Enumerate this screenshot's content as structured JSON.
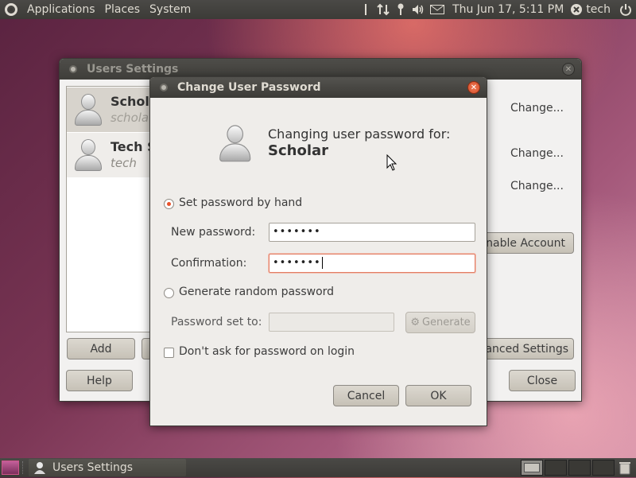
{
  "top_panel": {
    "menus": [
      "Applications",
      "Places",
      "System"
    ],
    "clock": "Thu Jun 17,  5:11 PM",
    "user": "tech"
  },
  "bottom_panel": {
    "task_label": "Users Settings"
  },
  "users_window": {
    "title": "Users Settings",
    "users": [
      {
        "name": "Schola",
        "login": "schola"
      },
      {
        "name": "Tech S",
        "login": "tech"
      }
    ],
    "change_buttons": [
      "Change...",
      "Change...",
      "Change..."
    ],
    "enable_account": "nable Account",
    "advanced_settings": "vanced Settings",
    "add": "Add",
    "help": "Help",
    "close": "Close"
  },
  "dialog": {
    "title": "Change User Password",
    "header_line1": "Changing user password for:",
    "header_user": "Scholar",
    "set_by_hand": "Set password by hand",
    "new_password_label": "New password:",
    "new_password_value": "•••••••",
    "confirmation_label": "Confirmation:",
    "confirmation_value": "•••••••",
    "generate_random": "Generate random password",
    "password_set_to_label": "Password set to:",
    "generate_button": "Generate",
    "dont_ask": "Don't ask for password on login",
    "cancel": "Cancel",
    "ok": "OK"
  },
  "colors": {
    "accent": "#e8522b",
    "panel": "#3c3b37",
    "window_bg": "#f2f1f0"
  }
}
